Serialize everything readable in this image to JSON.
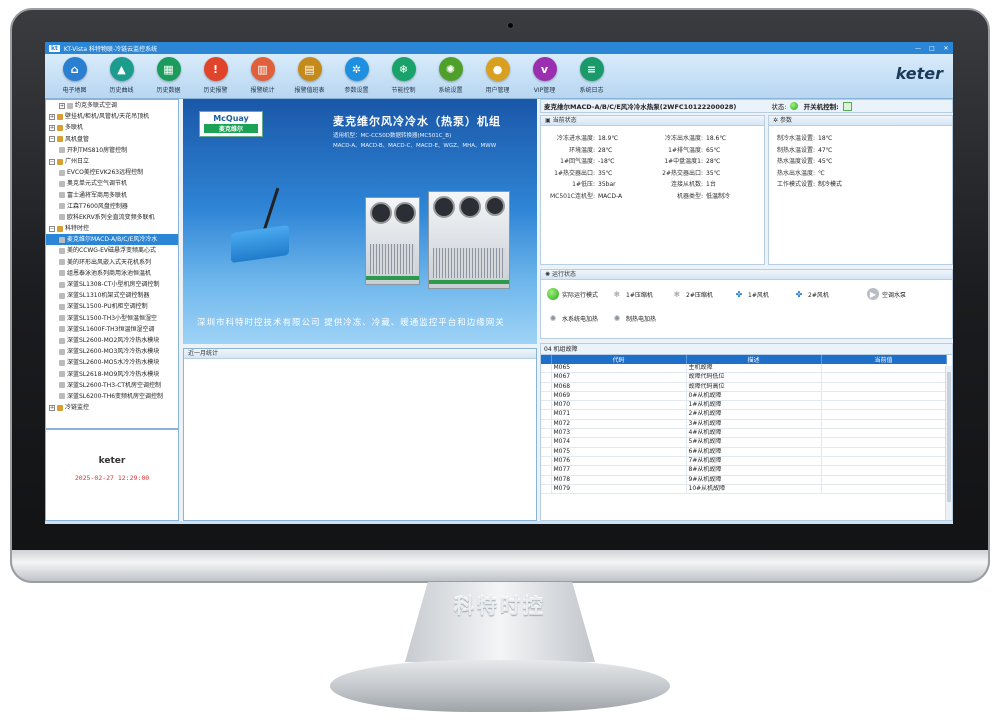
{
  "window": {
    "logo": "kt",
    "title": "KT-Vista 科特物联-冷链云监控系统",
    "controls": [
      "—",
      "□",
      "✕"
    ]
  },
  "toolbar": {
    "items": [
      {
        "label": "电子地图",
        "icon": "home-icon",
        "glyph": "⌂",
        "color": "#2b7fd0"
      },
      {
        "label": "历史曲线",
        "icon": "chart-icon",
        "glyph": "▲",
        "color": "#1c9c8c"
      },
      {
        "label": "历史数据",
        "icon": "table-icon",
        "glyph": "▦",
        "color": "#1c9c5c"
      },
      {
        "label": "历史报警",
        "icon": "alert-icon",
        "glyph": "!",
        "color": "#e0452c"
      },
      {
        "label": "报警统计",
        "icon": "bar-chart-icon",
        "glyph": "▥",
        "color": "#e0603c"
      },
      {
        "label": "报警值班表",
        "icon": "calendar-icon",
        "glyph": "▤",
        "color": "#c48a1c"
      },
      {
        "label": "参数设置",
        "icon": "gear-icon",
        "glyph": "✲",
        "color": "#1f8fe0"
      },
      {
        "label": "节能控制",
        "icon": "snowflake-icon",
        "glyph": "❄",
        "color": "#19a36a"
      },
      {
        "label": "系统设置",
        "icon": "settings-icon",
        "glyph": "✺",
        "color": "#4f9f2b"
      },
      {
        "label": "用户管理",
        "icon": "user-icon",
        "glyph": "●",
        "color": "#d9a020"
      },
      {
        "label": "VIP管理",
        "icon": "vip-icon",
        "glyph": "v",
        "color": "#9a2fb0"
      },
      {
        "label": "系统日志",
        "icon": "log-icon",
        "glyph": "≡",
        "color": "#1a9a6a"
      }
    ],
    "brand": "keter"
  },
  "tree": {
    "items": [
      {
        "label": "约克多联式空调",
        "exp": "+",
        "color": "#bbbbbb",
        "indent": 1
      },
      {
        "label": "壁挂机/柜机/风管机/天花吊顶机",
        "exp": "+",
        "color": "#d8a030",
        "indent": 0
      },
      {
        "label": "多联机",
        "exp": "+",
        "color": "#d8a030",
        "indent": 0
      },
      {
        "label": "风机盘管",
        "exp": "−",
        "color": "#d8a030",
        "indent": 0
      },
      {
        "label": "开利TMS810房管控制",
        "exp": "",
        "color": "#bbbbbb",
        "indent": 1
      },
      {
        "label": "广州日立",
        "exp": "−",
        "color": "#d8a030",
        "indent": 0
      },
      {
        "label": "EVCO美控EVK263远程控制",
        "exp": "",
        "color": "#bbbbbb",
        "indent": 1
      },
      {
        "label": "奥克单元式空气调节机",
        "exp": "",
        "color": "#bbbbbb",
        "indent": 1
      },
      {
        "label": "富士通将军商用多联机",
        "exp": "",
        "color": "#bbbbbb",
        "indent": 1
      },
      {
        "label": "江森T7600风盘控制器",
        "exp": "",
        "color": "#bbbbbb",
        "indent": 1
      },
      {
        "label": "欧科EKRV系列全直流变频多联机",
        "exp": "",
        "color": "#bbbbbb",
        "indent": 1
      },
      {
        "label": "科特时控",
        "exp": "−",
        "color": "#d8a030",
        "indent": 0
      },
      {
        "label": "麦克维尔MACD-A/B/C/E风冷冷水",
        "exp": "",
        "color": "#bbbbbb",
        "indent": 1,
        "selected": true
      },
      {
        "label": "美的CCWG-EV磁悬浮变频离心式",
        "exp": "",
        "color": "#bbbbbb",
        "indent": 1
      },
      {
        "label": "美的环形出风嵌入式天花机系列",
        "exp": "",
        "color": "#bbbbbb",
        "indent": 1
      },
      {
        "label": "组恩泰泳池系列商用泳池恒温机",
        "exp": "",
        "color": "#bbbbbb",
        "indent": 1
      },
      {
        "label": "深蓝SL1308-CT小型机房空调控制",
        "exp": "",
        "color": "#bbbbbb",
        "indent": 1
      },
      {
        "label": "深蓝SL1310机架式空调控制器",
        "exp": "",
        "color": "#bbbbbb",
        "indent": 1
      },
      {
        "label": "深蓝SL1500-PU机柜空调控制",
        "exp": "",
        "color": "#bbbbbb",
        "indent": 1
      },
      {
        "label": "深蓝SL1500-TH3小型恒温恒湿空",
        "exp": "",
        "color": "#bbbbbb",
        "indent": 1
      },
      {
        "label": "深蓝SL1600F-TH3恒温恒湿空调",
        "exp": "",
        "color": "#bbbbbb",
        "indent": 1
      },
      {
        "label": "深蓝SL2600-MO2风冷冷热水模块",
        "exp": "",
        "color": "#bbbbbb",
        "indent": 1
      },
      {
        "label": "深蓝SL2600-MO3风冷冷热水模块",
        "exp": "",
        "color": "#bbbbbb",
        "indent": 1
      },
      {
        "label": "深蓝SL2600-MO5水冷冷热水模块",
        "exp": "",
        "color": "#bbbbbb",
        "indent": 1
      },
      {
        "label": "深蓝SL2618-MO9风冷冷热水模块",
        "exp": "",
        "color": "#bbbbbb",
        "indent": 1
      },
      {
        "label": "深蓝SL2600-TH3-CT机房空调控制",
        "exp": "",
        "color": "#bbbbbb",
        "indent": 1
      },
      {
        "label": "深蓝SL6200-TH6变频机房空调控制",
        "exp": "",
        "color": "#bbbbbb",
        "indent": 1
      },
      {
        "label": "冷链监控",
        "exp": "+",
        "color": "#d8a030",
        "indent": 0
      }
    ]
  },
  "clock": {
    "brand": "keter",
    "datetime": "2025-02-27 12:29:00"
  },
  "banner": {
    "logo_en": "McQuay",
    "logo_cn": "麦克维尔",
    "title": "麦克维尔风冷冷水（热泵）机组",
    "sub1": "适用机型：MC-CC50D数据转换器(MC501C_B)",
    "sub2": "MACD-A、MACD-B、MACD-C、MACD-E、WGZ、MHA、MWW",
    "footer": "深圳市科特时控技术有限公司   提供冷冻、冷藏、暖通监控平台和边缘网关"
  },
  "stats": {
    "title": "近一月统计"
  },
  "device": {
    "name": "麦克维尔MACD-A/B/C/E风冷冷水热泵(2WFC10122200028)",
    "status_label": "状态:",
    "switch_label": "开关机控制:"
  },
  "current": {
    "title": "当前状态",
    "left": [
      {
        "k": "冷冻进水温度:",
        "v": "18.9℃"
      },
      {
        "k": "环境温度:",
        "v": "28℃"
      },
      {
        "k": "1#回气温度:",
        "v": "-18℃"
      },
      {
        "k": "1#热交器出口:",
        "v": "35℃"
      },
      {
        "k": "1#低压:",
        "v": "35bar"
      },
      {
        "k": "MC501C连机型:",
        "v": "MACD-A"
      }
    ],
    "right": [
      {
        "k": "冷冻出水温度:",
        "v": "18.6℃"
      },
      {
        "k": "1#排气温度:",
        "v": "65℃"
      },
      {
        "k": "1#中盘温度1:",
        "v": "28℃"
      },
      {
        "k": "2#热交器出口:",
        "v": "35℃"
      },
      {
        "k": "连接从机数:",
        "v": "1台"
      },
      {
        "k": "机器类型:",
        "v": "低温制冷"
      }
    ]
  },
  "params": {
    "title": "参数",
    "items": [
      {
        "k": "制冷水温设置:",
        "v": "18℃"
      },
      {
        "k": "制热水温设置:",
        "v": "47℃"
      },
      {
        "k": "热水温度设置:",
        "v": "45℃"
      },
      {
        "k": "热水出水温度:",
        "v": "℃"
      },
      {
        "k": "工作模式设置:",
        "v": "制冷模式"
      }
    ]
  },
  "run": {
    "title": "运行状态",
    "items": [
      {
        "label": "实际运行模式",
        "icon": "green-status-icon",
        "glyph": "",
        "active": true
      },
      {
        "label": "1#压缩机",
        "icon": "snowflake-icon",
        "glyph": "❄",
        "active": false
      },
      {
        "label": "2#压缩机",
        "icon": "snowflake-icon",
        "glyph": "❄",
        "active": false
      },
      {
        "label": "1#风机",
        "icon": "fan-icon",
        "glyph": "✤",
        "active": false
      },
      {
        "label": "2#风机",
        "icon": "fan-icon",
        "glyph": "✤",
        "active": false
      },
      {
        "label": "空调水泵",
        "icon": "pump-icon",
        "glyph": "▶",
        "active": false
      },
      {
        "label": "水系统电加热",
        "icon": "heater-icon",
        "glyph": "✺",
        "active": false
      },
      {
        "label": "制热电加热",
        "icon": "heater-icon",
        "glyph": "✺",
        "active": false
      }
    ]
  },
  "fault": {
    "tab": "04 机组故障",
    "columns": [
      "",
      "代码",
      "描述",
      "当前值"
    ],
    "rows": [
      {
        "code": "M065",
        "desc": "主机故障",
        "val": ""
      },
      {
        "code": "M067",
        "desc": "故障代码低位",
        "val": ""
      },
      {
        "code": "M068",
        "desc": "故障代码高位",
        "val": ""
      },
      {
        "code": "M069",
        "desc": "0#从机故障",
        "val": ""
      },
      {
        "code": "M070",
        "desc": "1#从机故障",
        "val": ""
      },
      {
        "code": "M071",
        "desc": "2#从机故障",
        "val": ""
      },
      {
        "code": "M072",
        "desc": "3#从机故障",
        "val": ""
      },
      {
        "code": "M073",
        "desc": "4#从机故障",
        "val": ""
      },
      {
        "code": "M074",
        "desc": "5#从机故障",
        "val": ""
      },
      {
        "code": "M075",
        "desc": "6#从机故障",
        "val": ""
      },
      {
        "code": "M076",
        "desc": "7#从机故障",
        "val": ""
      },
      {
        "code": "M077",
        "desc": "8#从机故障",
        "val": ""
      },
      {
        "code": "M078",
        "desc": "9#从机故障",
        "val": ""
      },
      {
        "code": "M079",
        "desc": "10#从机故障",
        "val": ""
      }
    ]
  },
  "stand": {
    "text": "科特时控"
  }
}
